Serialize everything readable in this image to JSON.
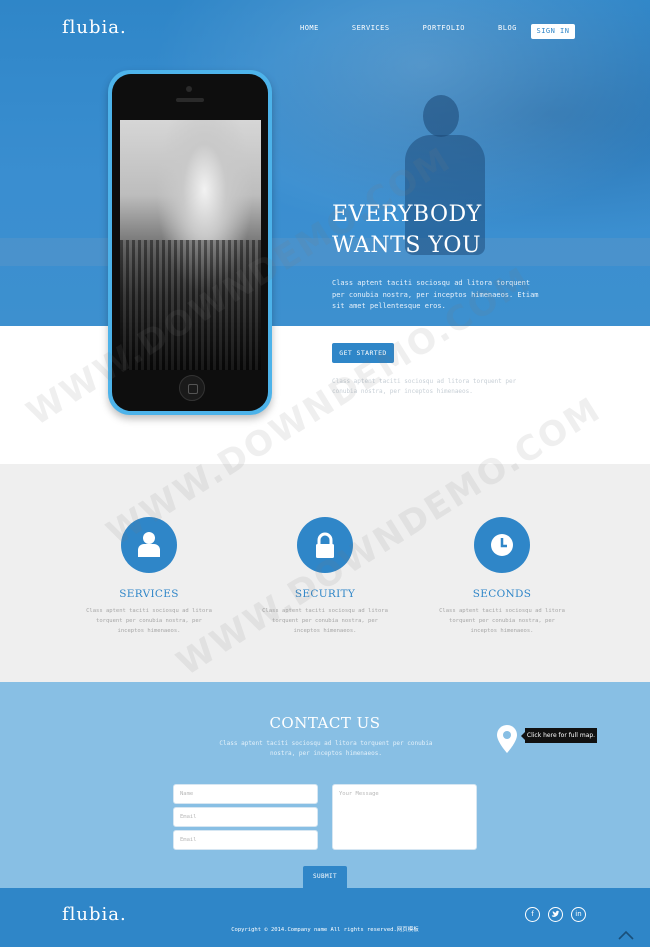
{
  "brand": {
    "logo": "flubia."
  },
  "nav": {
    "items": [
      "HOME",
      "SERVICES",
      "PORTFOLIO",
      "BLOG"
    ],
    "signin": "SIGN IN"
  },
  "hero": {
    "title_line1": "EVERYBODY",
    "title_line2": "WANTS YOU",
    "text": "Class aptent taciti sociosqu ad litora torquent per conubia nostra, per inceptos himenaeos. Etiam sit amet pellentesque eros.",
    "cta": "GET STARTED",
    "after_cta": "Class aptent taciti sociosqu ad litora torquent per conubia nostra, per inceptos himenaeos."
  },
  "features": [
    {
      "title": "SERVICES",
      "text": "Class aptent taciti sociosqu ad litora torquent per conubia nostra, per inceptos himenaeos.",
      "icon": "user-icon"
    },
    {
      "title": "SECURITY",
      "text": "Class aptent taciti sociosqu ad litora torquent per conubia nostra, per inceptos himenaeos.",
      "icon": "lock-icon"
    },
    {
      "title": "SECONDS",
      "text": "Class aptent taciti sociosqu ad litora torquent per conubia nostra, per inceptos himenaeos.",
      "icon": "clock-icon"
    }
  ],
  "contact": {
    "title": "CONTACT US",
    "text": "Class aptent taciti sociosqu ad litora torquent per conubia nostra, per inceptos himenaeos.",
    "map_tip": "Click here for full map.",
    "name_placeholder": "Name",
    "email_placeholder": "Email",
    "phone_placeholder": "Email",
    "message_placeholder": "Your Message",
    "submit": "SUBMIT"
  },
  "footer": {
    "logo": "flubia.",
    "copyright": "Copyright © 2014.Company name All rights reserved.网页模板"
  },
  "watermark": "WWW.DOWNDEMO.COM",
  "colors": {
    "primary": "#2f86c8",
    "contact_bg": "#88bfe4",
    "features_bg": "#efefef"
  }
}
